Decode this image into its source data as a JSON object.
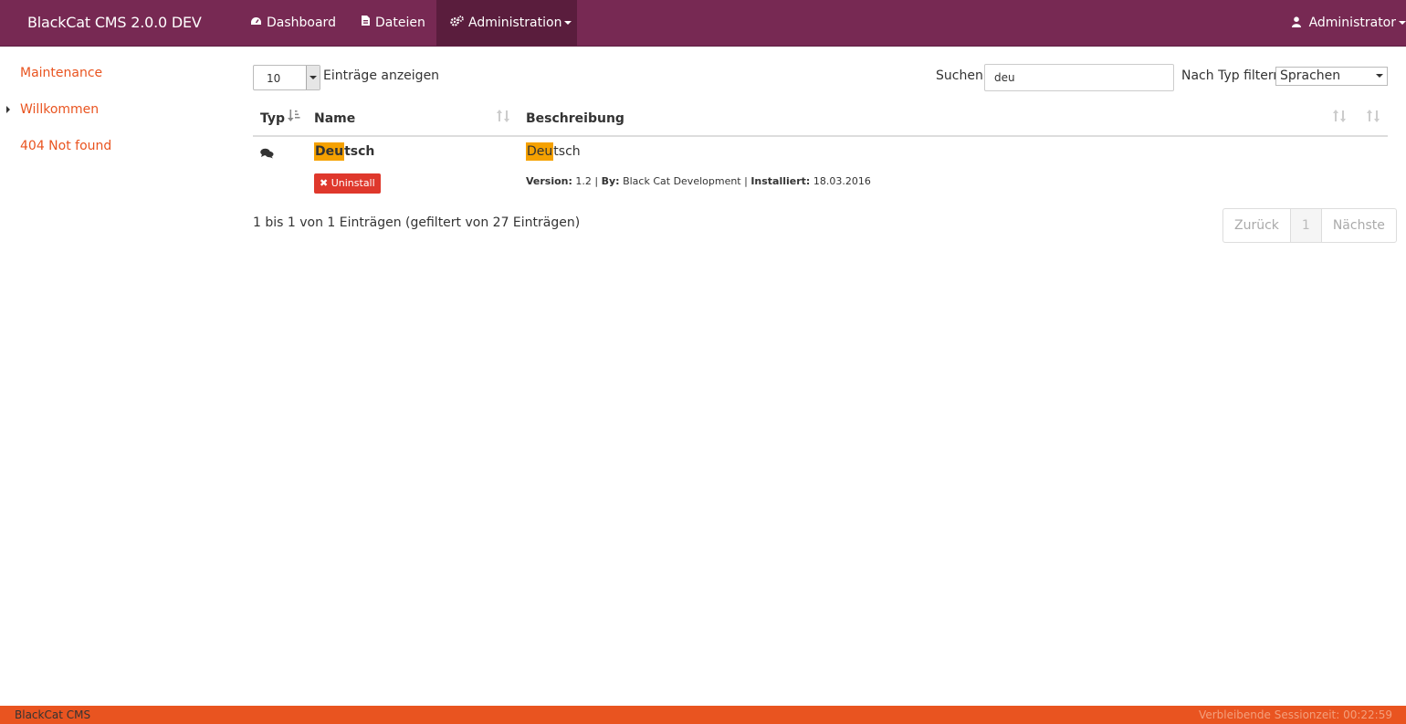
{
  "navbar": {
    "brand": "BlackCat CMS 2.0.0 DEV",
    "items": [
      {
        "label": "Dashboard",
        "icon": "dashboard-icon"
      },
      {
        "label": "Dateien",
        "icon": "file-icon"
      },
      {
        "label": "Administration",
        "icon": "cogs-icon",
        "active": true
      }
    ],
    "user": "Administrator",
    "colors": {
      "bar": "#772953",
      "active": "#5a1d3d"
    }
  },
  "sidebar": {
    "items": [
      {
        "label": "Maintenance"
      },
      {
        "label": "Willkommen",
        "current": true
      },
      {
        "label": "404 Not found"
      }
    ]
  },
  "controls": {
    "length_value": "10",
    "length_label": "Einträge anzeigen",
    "search_label": "Suchen",
    "search_value": "deu",
    "type_label": "Nach Typ filtern",
    "type_value": "Sprachen"
  },
  "table": {
    "headers": {
      "typ": "Typ",
      "name": "Name",
      "beschreibung": "Beschreibung"
    },
    "rows": [
      {
        "type_icon": "comments-icon",
        "name_match": "Deu",
        "name_rest": "tsch",
        "uninstall_label": "Uninstall",
        "desc_match": "Deu",
        "desc_rest": "tsch",
        "version_label": "Version:",
        "version": "1.2",
        "by_label": "By:",
        "by": "Black Cat Development",
        "installed_label": "Installiert:",
        "installed": "18.03.2016"
      }
    ]
  },
  "info": "1 bis 1 von 1 Einträgen (gefiltert von 27 Einträgen)",
  "pagination": {
    "prev": "Zurück",
    "page": "1",
    "next": "Nächste"
  },
  "footer": {
    "left": "BlackCat CMS",
    "right": "Verbleibende Sessionzeit: 00:22:59",
    "color": "#e95420"
  }
}
